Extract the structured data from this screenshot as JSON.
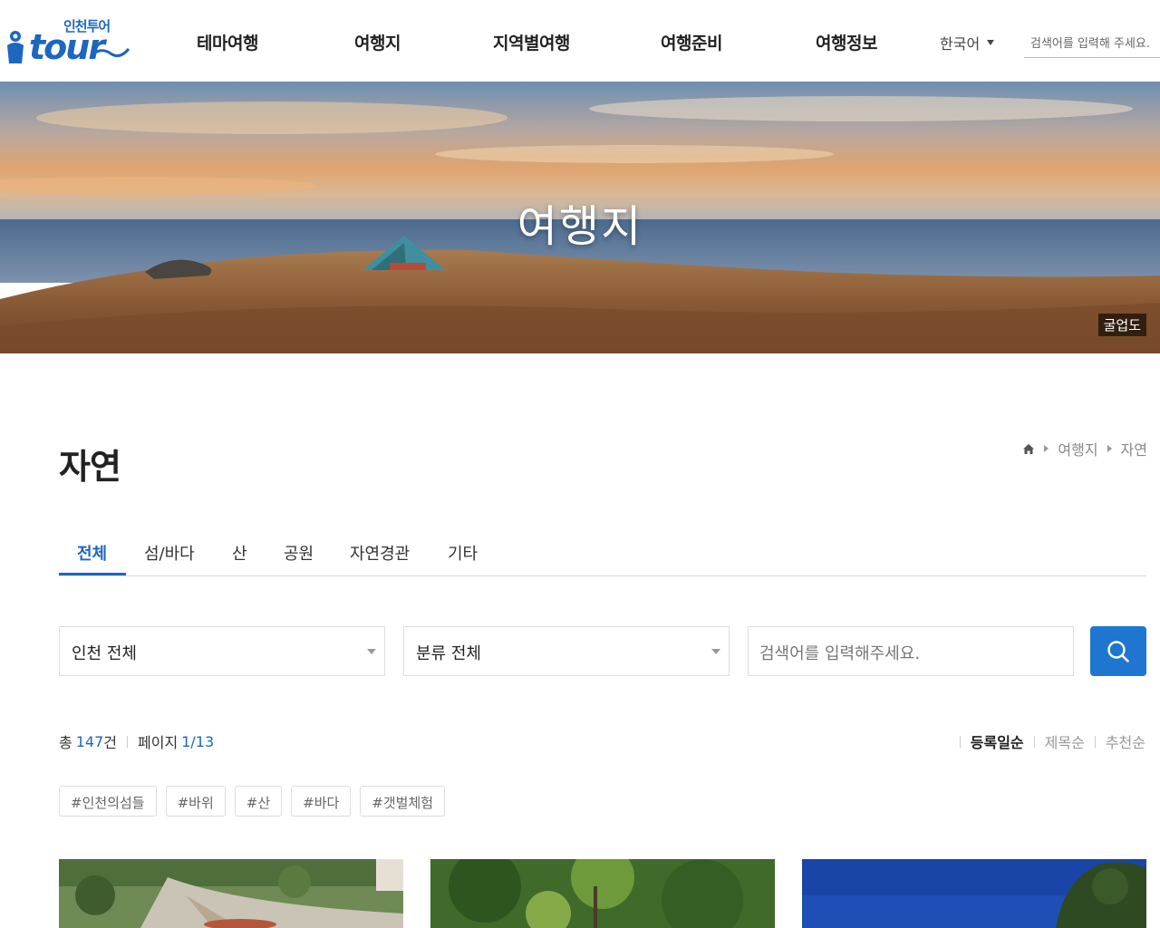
{
  "header": {
    "logo_sub": "인천투어",
    "logo_main": "tour",
    "nav": [
      {
        "label": "테마여행"
      },
      {
        "label": "여행지"
      },
      {
        "label": "지역별여행"
      },
      {
        "label": "여행준비"
      },
      {
        "label": "여행정보"
      }
    ],
    "language": "한국어",
    "search_placeholder": "검색어를 입력해 주세요."
  },
  "hero": {
    "title": "여행지",
    "caption": "굴업도"
  },
  "page": {
    "title": "자연",
    "breadcrumb": [
      "여행지",
      "자연"
    ]
  },
  "tabs": [
    {
      "label": "전체",
      "active": true
    },
    {
      "label": "섬/바다"
    },
    {
      "label": "산"
    },
    {
      "label": "공원"
    },
    {
      "label": "자연경관"
    },
    {
      "label": "기타"
    }
  ],
  "filters": {
    "region": "인천 전체",
    "category": "분류 전체",
    "search_placeholder": "검색어를 입력해주세요."
  },
  "results": {
    "total_prefix": "총",
    "total": "147",
    "total_suffix": "건",
    "page_label": "페이지",
    "page_current": "1",
    "page_total": "13"
  },
  "sort": [
    {
      "label": "등록일순",
      "active": true
    },
    {
      "label": "제목순"
    },
    {
      "label": "추천순"
    }
  ],
  "hashtags": [
    "#인천의섬들",
    "#바위",
    "#산",
    "#바다",
    "#갯벌체험"
  ],
  "colors": {
    "accent": "#1e66c0",
    "button": "#1e76d0"
  }
}
